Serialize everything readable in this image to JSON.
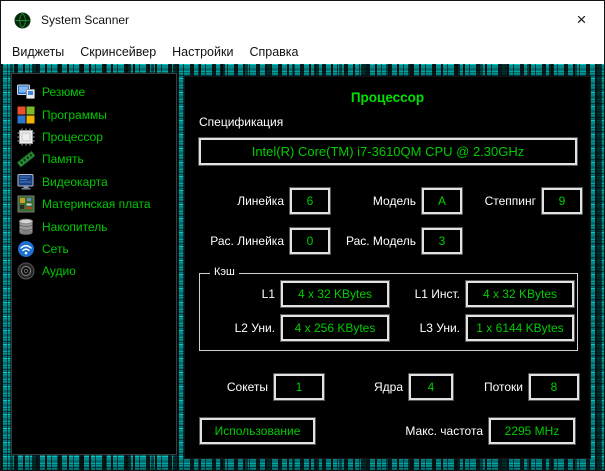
{
  "window": {
    "title": "System Scanner",
    "close_glyph": "×"
  },
  "menu": {
    "items": [
      "Виджеты",
      "Скринсейвер",
      "Настройки",
      "Справка"
    ]
  },
  "sidebar": {
    "items": [
      {
        "label": "Резюме",
        "icon": "computer-icon"
      },
      {
        "label": "Программы",
        "icon": "windows-logo-icon"
      },
      {
        "label": "Процессор",
        "icon": "cpu-chip-icon"
      },
      {
        "label": "Память",
        "icon": "ram-icon"
      },
      {
        "label": "Видеокарта",
        "icon": "gpu-icon"
      },
      {
        "label": "Материнская плата",
        "icon": "motherboard-icon"
      },
      {
        "label": "Накопитель",
        "icon": "storage-icon"
      },
      {
        "label": "Сеть",
        "icon": "network-icon"
      },
      {
        "label": "Аудио",
        "icon": "audio-icon"
      }
    ]
  },
  "main": {
    "title": "Процессор",
    "spec_label": "Спецификация",
    "spec_value": "Intel(R) Core(TM) i7-3610QM CPU @ 2.30GHz",
    "fields": {
      "family": {
        "label": "Линейка",
        "value": "6"
      },
      "model": {
        "label": "Модель",
        "value": "A"
      },
      "stepping": {
        "label": "Степпинг",
        "value": "9"
      },
      "ext_family": {
        "label": "Рас. Линейка",
        "value": "0"
      },
      "ext_model": {
        "label": "Рас. Модель",
        "value": "3"
      }
    },
    "cache": {
      "group_label": "Кэш",
      "l1": {
        "label": "L1",
        "value": "4 x 32 KBytes"
      },
      "l1_inst": {
        "label": "L1 Инст.",
        "value": "4 x 32 KBytes"
      },
      "l2": {
        "label": "L2 Уни.",
        "value": "4 x 256 KBytes"
      },
      "l3": {
        "label": "L3 Уни.",
        "value": "1 x 6144 KBytes"
      }
    },
    "counts": {
      "sockets": {
        "label": "Сокеты",
        "value": "1"
      },
      "cores": {
        "label": "Ядра",
        "value": "4"
      },
      "threads": {
        "label": "Потоки",
        "value": "8"
      }
    },
    "usage_button": "Использование",
    "max_freq": {
      "label": "Макс. частота",
      "value": "2295 MHz"
    }
  },
  "colors": {
    "value_green": "#00cc00",
    "title_green": "#00e100",
    "label_white": "#ffffff",
    "circuit_teal": "#00d9d9",
    "panel_black": "#000000"
  }
}
